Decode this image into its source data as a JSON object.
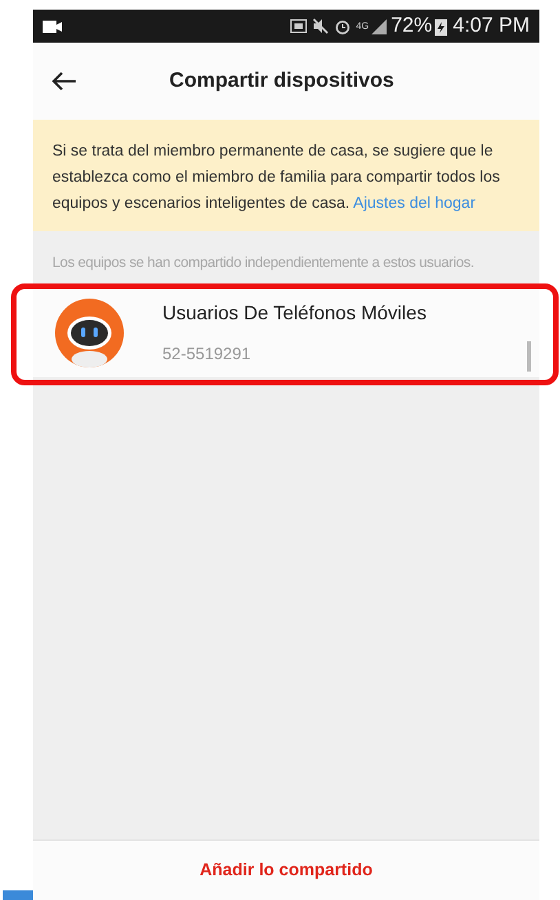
{
  "status_bar": {
    "battery": "72%",
    "time": "4:07 PM",
    "network": "4G"
  },
  "header": {
    "title": "Compartir dispositivos"
  },
  "notice": {
    "text": "Si se trata del miembro permanente de casa, se sugiere que le establezca como el miembro de familia para compartir todos los equipos y escenarios inteligentes de casa.",
    "link": "Ajustes del hogar"
  },
  "section_caption": "Los equipos se han compartido independientemente a estos usuarios.",
  "users": [
    {
      "name": "Usuarios De Teléfonos Móviles",
      "phone": "52-5519291",
      "highlighted": true
    }
  ],
  "add_button": "Añadir lo compartido"
}
